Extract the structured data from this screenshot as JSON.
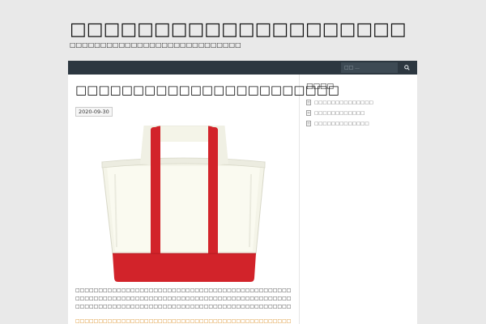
{
  "site": {
    "title": "□□□□□□□□□□□□□□□□□□□□",
    "tagline": "□□□□□□□□□□□□□□□□□□□□□□□□□□□□"
  },
  "search": {
    "placeholder": "□□ ...",
    "icon": "search-icon"
  },
  "post": {
    "title": "□□□□□□□□□□□□□□□□□□□□□□□",
    "date": "2020-09-30",
    "image": {
      "icon": "tote-bag-illustration",
      "bag_color": "#f4f4e8",
      "handle_color": "#d2232a"
    },
    "text_lines": [
      "□□□□□□□□□□□□□□□□□□□□□□□□□□□□□□□□□□□□□□□□□□□□□□□□□□□□□□□□□□□□□□□□□□□□□□□□□□□",
      "□□□□□□□□□□□□□□□□□□□□□□□□□□□□□□□□□□□□□□□□□□□□□□□□□□□□□□□□□□□□□□□□□□□□□□□□□□□",
      "□□□□□□□□□□□□□□□□□□□□□□□□□□□□□□□□□□□□□□□□□□□□□□□□□□□□□□"
    ],
    "highlight_line": "□□□□□□□□□□□□□□□□□□□□□□□□□□□□□□□□□□□□□□□□□□□□□□□□□□□□□□□□□□□□□□□□□□□□□□□□□□□"
  },
  "sidebar": {
    "title": "□□□□",
    "items": [
      {
        "label": "□□□□□□□□□□□□□□",
        "icon": "document-icon"
      },
      {
        "label": "□□□□□□□□□□□□",
        "icon": "document-icon"
      },
      {
        "label": "□□□□□□□□□□□□□",
        "icon": "document-icon"
      }
    ]
  },
  "colors": {
    "background": "#e9e9e9",
    "navbar": "#2c3740",
    "content": "#ffffff",
    "highlight_text": "#d98a1c"
  }
}
